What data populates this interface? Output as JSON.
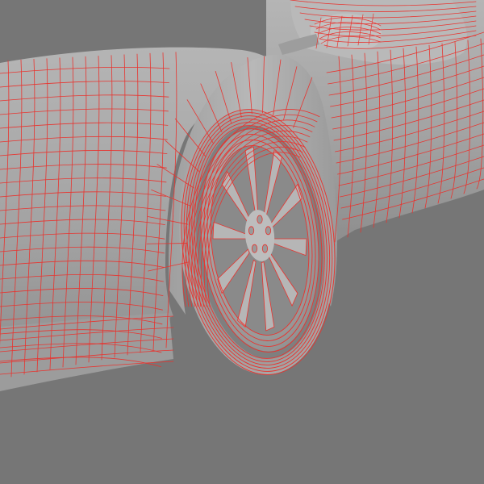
{
  "scene": {
    "subject": "car-wireframe-render",
    "background_color": "#767676",
    "body_color": "#a9a9a9",
    "body_shadow_color": "#8c8c8c",
    "highlight_color": "#c7c7c7",
    "wire_color": "#e8342f",
    "tire_color": "#9b9b9b",
    "rim_color": "#b3b3b3"
  },
  "wheel": {
    "spoke_count": 10,
    "lug_count": 5
  }
}
